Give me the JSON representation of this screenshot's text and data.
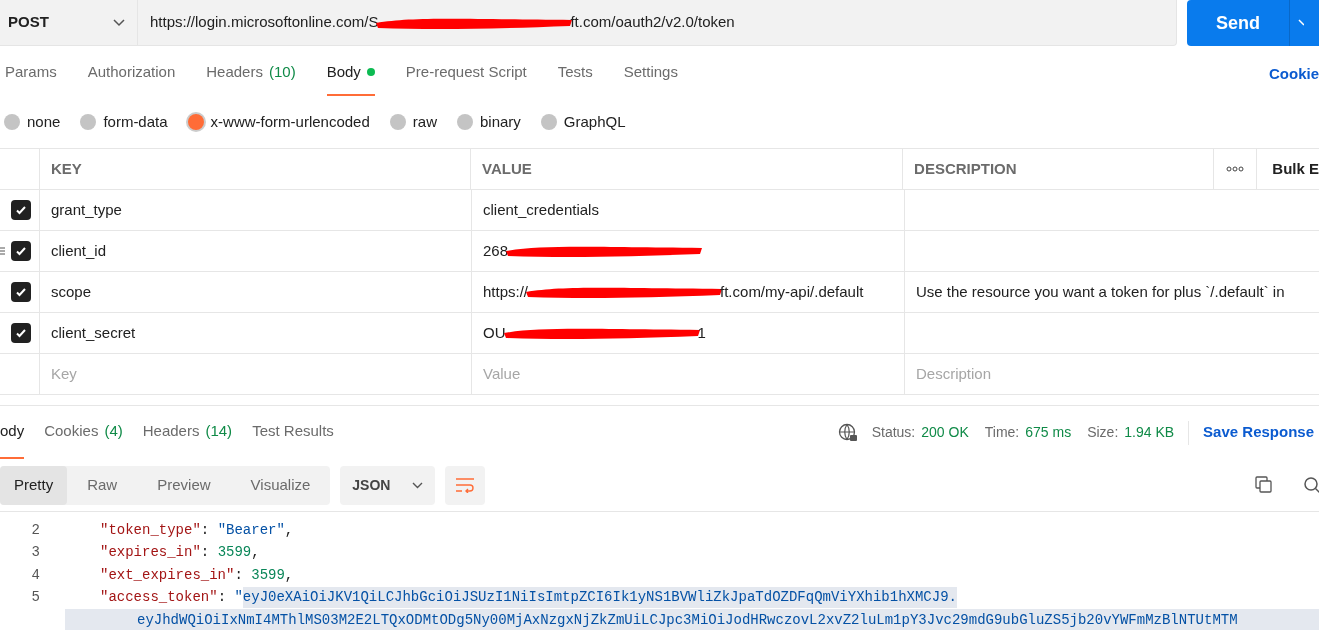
{
  "request": {
    "method": "POST",
    "url_prefix": "https://login.microsoftonline.com/S",
    "url_suffix": "ft.com/oauth2/v2.0/token",
    "send": "Send"
  },
  "tabs": [
    {
      "label": "Params",
      "selected": false
    },
    {
      "label": "Authorization",
      "selected": false
    },
    {
      "label": "Headers",
      "count": "(10)",
      "selected": false
    },
    {
      "label": "Body",
      "dot": true,
      "selected": true
    },
    {
      "label": "Pre-request Script",
      "selected": false
    },
    {
      "label": "Tests",
      "selected": false
    },
    {
      "label": "Settings",
      "selected": false
    }
  ],
  "cookies_link": "Cookie",
  "body_types": [
    {
      "label": "none",
      "selected": false
    },
    {
      "label": "form-data",
      "selected": false
    },
    {
      "label": "x-www-form-urlencoded",
      "selected": true
    },
    {
      "label": "raw",
      "selected": false
    },
    {
      "label": "binary",
      "selected": false
    },
    {
      "label": "GraphQL",
      "selected": false
    }
  ],
  "table": {
    "columns": [
      "KEY",
      "VALUE",
      "DESCRIPTION"
    ],
    "bulk_edit": "Bulk E",
    "rows": [
      {
        "checked": true,
        "key": "grant_type",
        "value_prefix": "client_credentials"
      },
      {
        "checked": true,
        "key": "client_id",
        "value_prefix": "268",
        "redacted": true,
        "drag_handle": true
      },
      {
        "checked": true,
        "key": "scope",
        "value_prefix": "https://",
        "redacted": true,
        "value_suffix": "ft.com/my-api/.default",
        "description": "Use the resource you want a token for plus `/.default` in"
      },
      {
        "checked": true,
        "key": "client_secret",
        "value_prefix": "OU",
        "redacted": true,
        "value_suffix": "1"
      }
    ],
    "placeholders": {
      "key": "Key",
      "value": "Value",
      "description": "Description"
    }
  },
  "response": {
    "tabs": [
      {
        "label": "ody",
        "selected": true
      },
      {
        "label": "Cookies",
        "count": "(4)",
        "selected": false
      },
      {
        "label": "Headers",
        "count": "(14)",
        "selected": false
      },
      {
        "label": "Test Results",
        "selected": false
      }
    ],
    "status_label": "Status:",
    "status": "200 OK",
    "time_label": "Time:",
    "time": "675 ms",
    "size_label": "Size:",
    "size": "1.94 KB",
    "save": "Save Response",
    "views": [
      {
        "label": "Pretty",
        "selected": true
      },
      {
        "label": "Raw",
        "selected": false
      },
      {
        "label": "Preview",
        "selected": false
      },
      {
        "label": "Visualize",
        "selected": false
      }
    ],
    "format": "JSON",
    "lines": [
      {
        "number": "2",
        "segments": [
          {
            "kind": "key",
            "text": "\"token_type\""
          },
          {
            "kind": "punct",
            "text": ": "
          },
          {
            "kind": "string",
            "text": "\"Bearer\""
          },
          {
            "kind": "punct",
            "text": ","
          }
        ]
      },
      {
        "number": "3",
        "segments": [
          {
            "kind": "key",
            "text": "\"expires_in\""
          },
          {
            "kind": "punct",
            "text": ": "
          },
          {
            "kind": "number",
            "text": "3599"
          },
          {
            "kind": "punct",
            "text": ","
          }
        ]
      },
      {
        "number": "4",
        "segments": [
          {
            "kind": "key",
            "text": "\"ext_expires_in\""
          },
          {
            "kind": "punct",
            "text": ": "
          },
          {
            "kind": "number",
            "text": "3599"
          },
          {
            "kind": "punct",
            "text": ","
          }
        ]
      },
      {
        "number": "5",
        "segments": [
          {
            "kind": "key",
            "text": "\"access_token\""
          },
          {
            "kind": "punct",
            "text": ": "
          },
          {
            "kind": "string",
            "text": "\""
          },
          {
            "kind": "string",
            "text": "eyJ0eXAiOiJKV1QiLCJhbGciOiJSUzI1NiIsImtpZCI6Ik1yNS1BVWliZkJpaTdOZDFqQmViYXhib1hXMCJ9.",
            "selected": true
          }
        ]
      },
      {
        "continuation": true,
        "segments": [
          {
            "kind": "string",
            "text": "eyJhdWQiOiIxNmI4MThlMS03M2E2LTQxODMtODg5Ny00MjAxNzgxNjZkZmUiLCJpc3MiOiJodHRwczovL2xvZ2luLm1pY3Jvc29mdG9ubGluZS5jb20vYWFmMzBlNTUtMTM",
            "selected": true
          }
        ]
      }
    ]
  }
}
